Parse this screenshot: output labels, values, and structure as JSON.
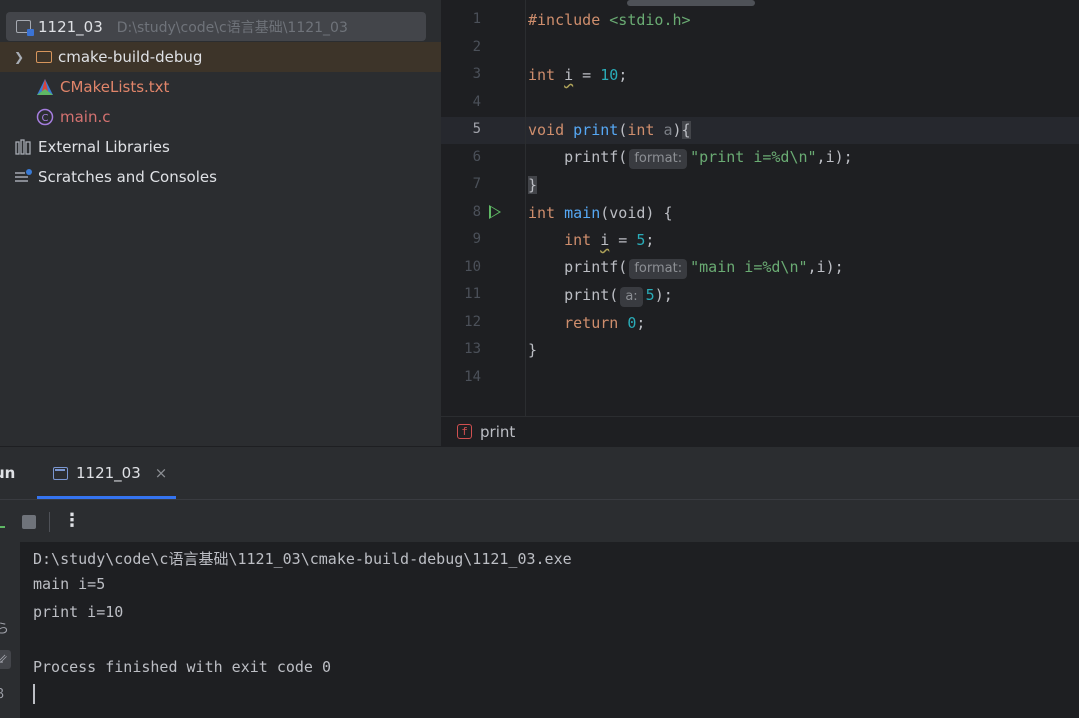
{
  "project_tree": {
    "root": {
      "name": "1121_03",
      "path": "D:\\study\\code\\c语言基础\\1121_03"
    },
    "items": [
      {
        "label": "cmake-build-debug",
        "kind": "folder"
      },
      {
        "label": "CMakeLists.txt",
        "kind": "cmake"
      },
      {
        "label": "main.c",
        "kind": "c-file"
      },
      {
        "label": "External Libraries",
        "kind": "libraries"
      },
      {
        "label": "Scratches and Consoles",
        "kind": "scratches"
      }
    ]
  },
  "editor": {
    "line_numbers": [
      "1",
      "2",
      "3",
      "4",
      "5",
      "6",
      "7",
      "8",
      "9",
      "10",
      "11",
      "12",
      "13",
      "14"
    ],
    "code": {
      "l1_directive": "#include",
      "l1_header": "<stdio.h>",
      "l3_type": "int",
      "l3_var": "i",
      "l3_eq": " = ",
      "l3_num": "10",
      "l3_semi": ";",
      "l5_type": "void",
      "l5_fn": "print",
      "l5_open": "(",
      "l5_ptype": "int",
      "l5_param": "a",
      "l5_close": ")",
      "l5_brace": "{",
      "l6_indent": "    ",
      "l6_call": "printf(",
      "l6_hint": "format:",
      "l6_str": "\"print i=%d\\n\"",
      "l6_rest": ",i);",
      "l7_brace": "}",
      "l8_type": "int",
      "l8_fn": "main",
      "l8_rest": "(void) {",
      "l9_indent": "    ",
      "l9_type": "int",
      "l9_var": "i",
      "l9_eq": " = ",
      "l9_num": "5",
      "l9_semi": ";",
      "l10_call": "printf(",
      "l10_hint": "format:",
      "l10_str": "\"main i=%d\\n\"",
      "l10_rest": ",i);",
      "l11_call": "print(",
      "l11_hint": "a:",
      "l11_num": "5",
      "l11_rest": ");",
      "l12_kw": "return",
      "l12_num": "0",
      "l12_semi": ";",
      "l13_brace": "}"
    },
    "current_line": 5
  },
  "breadcrumb": {
    "badge": "f",
    "label": "print"
  },
  "run_window": {
    "title": "un",
    "tab_label": "1121_03",
    "tab_close": "×",
    "more": "⋮",
    "console_lines": [
      "D:\\study\\code\\c语言基础\\1121_03\\cmake-build-debug\\1121_03.exe",
      "main i=5",
      "print i=10",
      "",
      "Process finished with exit code 0"
    ],
    "side_glyphs": [
      "ら",
      "⇙",
      "ꞵ"
    ]
  },
  "colors": {
    "accent": "#3574f0",
    "keyword": "#cf8e6d",
    "function": "#56a8f5",
    "number": "#2aacb8",
    "string": "#6aab73",
    "run_green": "#5fb865"
  },
  "icons": [
    "chevron-right-icon",
    "folder-icon",
    "cmake-icon",
    "c-file-icon",
    "libraries-icon",
    "scratches-icon",
    "run-icon",
    "stop-icon",
    "more-icon",
    "close-icon"
  ]
}
